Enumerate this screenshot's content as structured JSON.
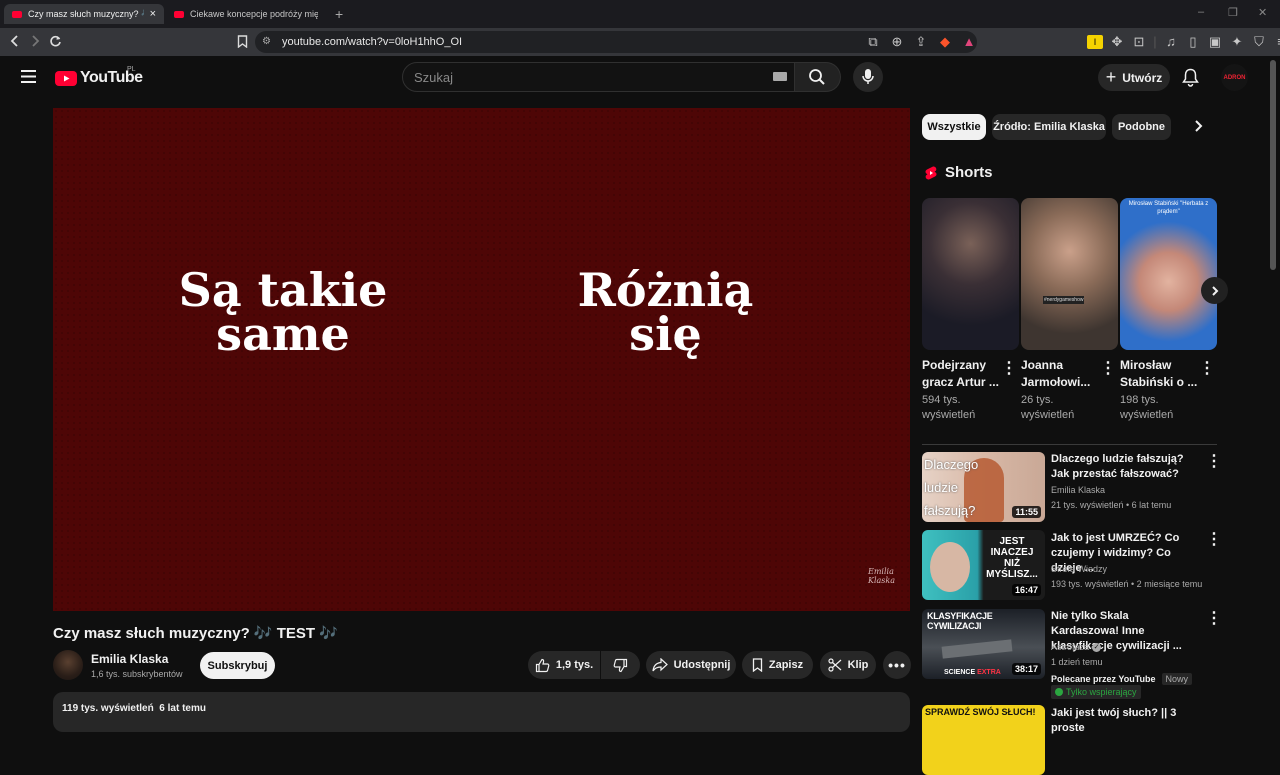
{
  "browser": {
    "tabs": [
      {
        "title": "Czy masz słuch muzyczny? 🎶 T",
        "close": "×"
      },
      {
        "title": "Ciekawe koncepcje podróży między"
      }
    ],
    "new_tab": "+",
    "url": "youtube.com/watch?v=0loH1hhO_OI",
    "window_controls": {
      "minimize": "–",
      "restore": "❐",
      "close": "✕"
    }
  },
  "header": {
    "logo": "YouTube",
    "region": "PL",
    "search_placeholder": "Szukaj",
    "create_label": "Utwórz",
    "avatar_text": "ADRON"
  },
  "video": {
    "left_text": "Są takie\nsame",
    "right_text": "Różnią\nsię",
    "watermark": "Emilia Klaska",
    "title": "Czy masz słuch muzyczny? 🎶 TEST 🎶",
    "channel": "Emilia Klaska",
    "subscribers": "1,6 tys. subskrybentów",
    "subscribe": "Subskrybuj",
    "likes": "1,9 tys.",
    "share": "Udostępnij",
    "save": "Zapisz",
    "clip": "Klip",
    "views_date": "119 tys. wyświetleń  6 lat temu"
  },
  "chips": [
    "Wszystkie",
    "Źródło: Emilia Klaska",
    "Podobne"
  ],
  "shorts": {
    "heading": "Shorts",
    "items": [
      {
        "title": "Podejrzany gracz Artur ...",
        "views": "594 tys. wyświetleń",
        "color": "#2a2a38"
      },
      {
        "title": "Joanna Jarmołowi...",
        "views": "26 tys. wyświetleń",
        "color": "#6b5a4a",
        "overlay": "#nerdygameshow"
      },
      {
        "title": "Mirosław Stabiński o ...",
        "views": "198 tys. wyświetleń",
        "color": "#2f6fc9",
        "overlay": "Mirosław Stabiński \"Herbata z prądem\""
      }
    ]
  },
  "videos": [
    {
      "title": "Dlaczego ludzie fałszują? Jak przestać fałszować?",
      "channel": "Emilia Klaska",
      "meta": "21 tys. wyświetleń • 6 lat temu",
      "duration": "11:55",
      "thumb_text": "Dlaczego\nludzie\nfałszują?",
      "color": "#d9c2b3"
    },
    {
      "title": "Jak to jest UMRZEĆ? Co czujemy i widzimy? Co dzieje ...",
      "channel": "Strefa Wiedzy",
      "meta": "193 tys. wyświetleń • 2 miesiące temu",
      "duration": "16:47",
      "thumb_text": "JEST\nINACZEJ\nNIŻ\nMYŚLISZ...",
      "color": "#2fa5a5"
    },
    {
      "title": "Nie tylko Skala Kardaszowa! Inne klasyfikacje cywilizacji ...",
      "channel": "Astrofaza",
      "meta": "1 dzień temu",
      "duration": "38:17",
      "thumb_text": "KLASYFIKACJE CYWILIZACJI",
      "extra1": "Polecane przez YouTube",
      "badge": "Nowy",
      "extra2": "Tylko wspierający",
      "science": "SCIENCE",
      "science_extra": "EXTRA",
      "color": "#3a3f46"
    },
    {
      "title": "Jaki jest twój słuch? || 3 proste",
      "thumb_text": "SPRAWDŹ SWÓJ SŁUCH!",
      "color": "#f2d21b"
    }
  ]
}
